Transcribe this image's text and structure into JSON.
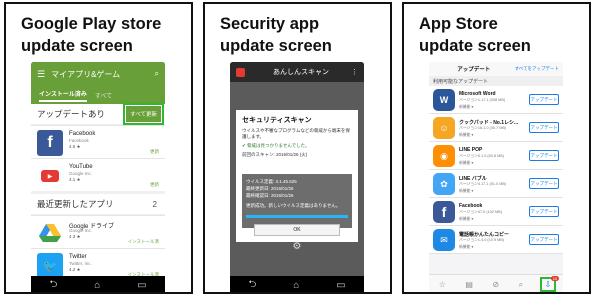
{
  "panels": [
    {
      "title_line1": "Google Play store",
      "title_line2": "update screen"
    },
    {
      "title_line1": "Security app",
      "title_line2": "update screen"
    },
    {
      "title_line1": "App Store",
      "title_line2": "update screen"
    }
  ],
  "colors": {
    "google_play_green": "#689f38",
    "highlight_green": "#2eb82e",
    "ios_blue": "#1e7ce6"
  },
  "google_play": {
    "header_title": "マイアプリ&ゲーム",
    "tab_installed": "インストール済み",
    "tab_all": "すべて",
    "updates_section": "アップデートあり",
    "update_all_button": "すべて更新",
    "apps_update": [
      {
        "name": "Facebook",
        "developer": "Facebook",
        "rating": "4.0 ★",
        "action": "更新",
        "icon": "facebook-icon",
        "color": "#3b5998"
      },
      {
        "name": "YouTube",
        "developer": "Google Inc.",
        "rating": "4.1 ★",
        "action": "更新",
        "icon": "youtube-icon",
        "color": "#e53935"
      }
    ],
    "recent_section": "最近更新したアプリ",
    "recent_count": "2",
    "apps_recent": [
      {
        "name": "Google ドライブ",
        "developer": "Google Inc.",
        "rating": "4.3 ★",
        "action": "インストール済",
        "icon": "google-drive-icon",
        "color": "#fbc02d"
      },
      {
        "name": "Twitter",
        "developer": "Twitter, Inc.",
        "rating": "4.2 ★",
        "action": "インストール済",
        "icon": "twitter-icon",
        "color": "#1da1f2"
      }
    ]
  },
  "security": {
    "app_title": "あんしんスキャン",
    "dialog_title": "セキュリティスキャン",
    "dialog_desc": "ウイルスや不審なプログラムなどの脅威から端末を保護します。",
    "result_ok": "✔ 脅威は見つかりませんでした。",
    "last_scan": "前回のスキャン: 2016/01/26 (火)",
    "def_version": "ウイルス定義: 3.1.45.525",
    "update_date": "最終更新日: 2016/01/26",
    "check_date": "最終確認日: 2016/01/26",
    "update_result": "更新成功。新しいウイルス定義はありません。",
    "ok_button": "OK"
  },
  "app_store": {
    "header_title": "アップデート",
    "update_all_link": "すべてをアップデート",
    "available_label": "利用可能なアップデート",
    "update_button": "アップデート",
    "apps": [
      {
        "name": "Microsoft Word",
        "version": "バージョン1.17.1 (308 MB)",
        "new": "新機能 ▾",
        "icon": "word-icon",
        "color": "#2b579a",
        "glyph": "W"
      },
      {
        "name": "クックパッド - No.1レシ...",
        "version": "バージョン16.1.0 (30.7 MB)",
        "new": "新機能 ▾",
        "icon": "cookpad-icon",
        "color": "#f5a623",
        "glyph": "☺"
      },
      {
        "name": "LINE POP",
        "version": "バージョン5.1.0 (83.8 MB)",
        "new": "新機能 ▾",
        "icon": "line-pop-icon",
        "color": "#ff8f00",
        "glyph": "◉"
      },
      {
        "name": "LINE バブル",
        "version": "バージョン4.17.1 (51.0 MB)",
        "new": "新機能 ▾",
        "icon": "line-bubble-icon",
        "color": "#42a5f5",
        "glyph": "✿"
      },
      {
        "name": "Facebook",
        "version": "バージョン47.0 (102 MB)",
        "new": "新機能 ▾",
        "icon": "facebook-icon",
        "color": "#3b5998",
        "glyph": "f"
      },
      {
        "name": "電話帳かんたんコピー",
        "version": "バージョン1.4.0 (10.9 MB)",
        "new": "新機能 ▾",
        "icon": "contacts-copy-icon",
        "color": "#1e88e5",
        "glyph": "✉"
      }
    ],
    "badge_count": "10"
  }
}
